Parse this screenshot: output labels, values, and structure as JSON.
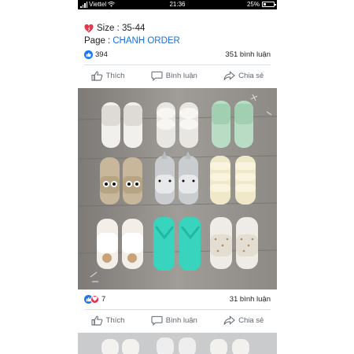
{
  "status_bar": {
    "carrier": "Viettel",
    "time": "21:36",
    "battery": "25%"
  },
  "post1": {
    "size_line": "Size : 35-44",
    "page_label": "Page :",
    "page_name": "CHANH ORDER",
    "like_count": "394",
    "comment_count": "351 bình luận"
  },
  "post2": {
    "reaction_count": "7",
    "comment_count": "31 bình luận"
  },
  "actions": {
    "like": "Thích",
    "comment": "Bình luận",
    "share": "Chia sẻ"
  },
  "colors": {
    "facebook_blue": "#1877f2",
    "love_red": "#f0284a",
    "link_blue": "#1a6ed8"
  },
  "icons": [
    "heart-icon",
    "like-icon",
    "love-icon",
    "thumbs-up-icon",
    "comment-icon",
    "share-icon",
    "wifi-icon",
    "battery-icon",
    "signal-icon"
  ]
}
